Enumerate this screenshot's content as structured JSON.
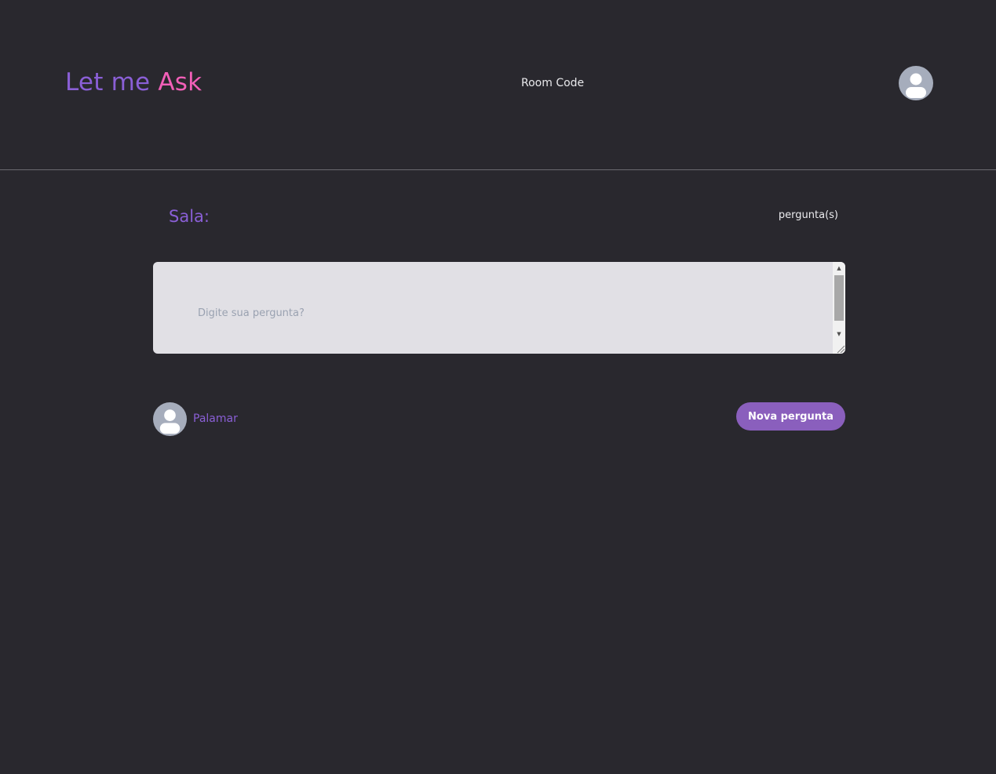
{
  "header": {
    "logo_part1": "Let me",
    "logo_part2": "Ask",
    "room_code_label": "Room Code",
    "avatar_icon": "user-avatar-icon"
  },
  "room": {
    "title": "Sala:",
    "question_count_label": "pergunta(s)"
  },
  "question_form": {
    "placeholder": "Digite sua pergunta?",
    "value": ""
  },
  "user": {
    "name": "Palamar",
    "avatar_icon": "user-avatar-icon"
  },
  "actions": {
    "submit_label": "Nova pergunta"
  },
  "colors": {
    "background": "#29282e",
    "accent_purple": "#8a5fd6",
    "accent_pink": "#f25fb8",
    "button": "#8a5fbd",
    "input_bg": "#e1e0e5",
    "avatar_bg": "#a6adbc"
  }
}
